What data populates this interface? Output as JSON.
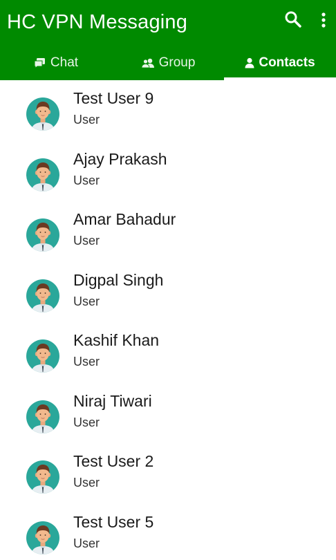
{
  "app": {
    "title": "HC VPN Messaging",
    "accent_color": "#008a00",
    "search_icon": "search-icon",
    "more_icon": "more-vert-icon"
  },
  "tabs": [
    {
      "label": "Chat",
      "icon": "chat-icon",
      "active": false
    },
    {
      "label": "Group",
      "icon": "group-icon",
      "active": false
    },
    {
      "label": "Contacts",
      "icon": "person-icon",
      "active": true
    }
  ],
  "contacts": [
    {
      "name": "Test User 9",
      "role": "User"
    },
    {
      "name": "Ajay Prakash",
      "role": "User"
    },
    {
      "name": "Amar Bahadur",
      "role": "User"
    },
    {
      "name": "Digpal Singh",
      "role": "User"
    },
    {
      "name": "Kashif Khan",
      "role": "User"
    },
    {
      "name": "Niraj Tiwari",
      "role": "User"
    },
    {
      "name": "Test User 2",
      "role": "User"
    },
    {
      "name": "Test User 5",
      "role": "User"
    }
  ]
}
